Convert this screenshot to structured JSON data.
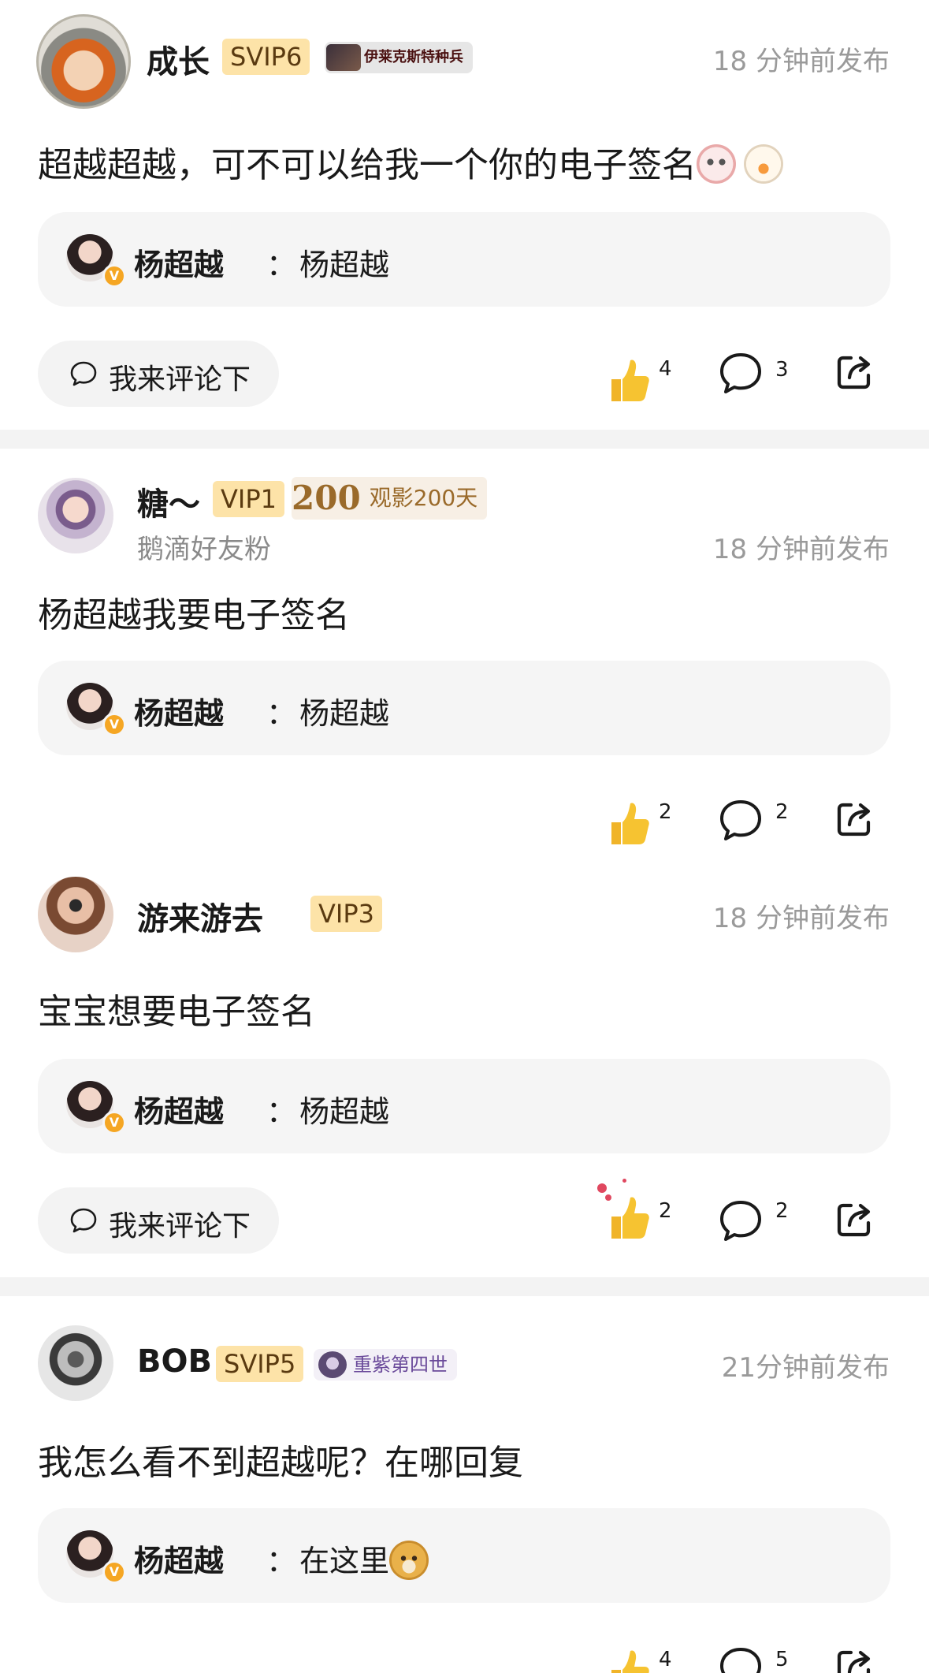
{
  "posts": [
    {
      "username": "成长",
      "vip": "SVIP6",
      "medal": "伊莱克斯特种兵",
      "time": "18 分钟前发布",
      "content": "超越超越，可不可以给我一个你的电子签名",
      "content_emojis": [
        "panda-face-emoji",
        "duck-emoji"
      ],
      "reply": {
        "name": "杨超越",
        "sep": "：",
        "text": "杨超越"
      },
      "comment_button": "我来评论下",
      "likes": "4",
      "comments": "3"
    },
    {
      "username": "糖～",
      "vip": "VIP1",
      "badge_number": "200",
      "badge_text": "观影200天",
      "subline": "鹅滴好友粉",
      "time": "18 分钟前发布",
      "content": "杨超越我要电子签名",
      "reply": {
        "name": "杨超越",
        "sep": "：",
        "text": "杨超越"
      },
      "likes": "2",
      "comments": "2"
    },
    {
      "username": "游来游去",
      "vip": "VIP3",
      "time": "18 分钟前发布",
      "content": "宝宝想要电子签名",
      "reply": {
        "name": "杨超越",
        "sep": "：",
        "text": "杨超越"
      },
      "comment_button": "我来评论下",
      "likes": "2",
      "comments": "2"
    },
    {
      "username": "BOB",
      "vip": "SVIP5",
      "medal": "重紫第四世",
      "time": "21分钟前发布",
      "content": "我怎么看不到超越呢？在哪回复",
      "reply": {
        "name": "杨超越",
        "sep": "：",
        "text": "在这里",
        "emoji": "doge-emoji"
      },
      "likes": "4",
      "comments": "5"
    }
  ],
  "colors": {
    "vip_badge_bg": "#fde3a8",
    "reply_bg": "#f5f5f5",
    "divider": "#f3f3f3",
    "time_text": "#9a9a9a",
    "verified_badge": "#f5a623",
    "thumb_emoji": "#f6c331"
  },
  "icons": {
    "like": "thumbs-up-icon",
    "comment": "speech-bubble-icon",
    "share": "share-icon"
  }
}
